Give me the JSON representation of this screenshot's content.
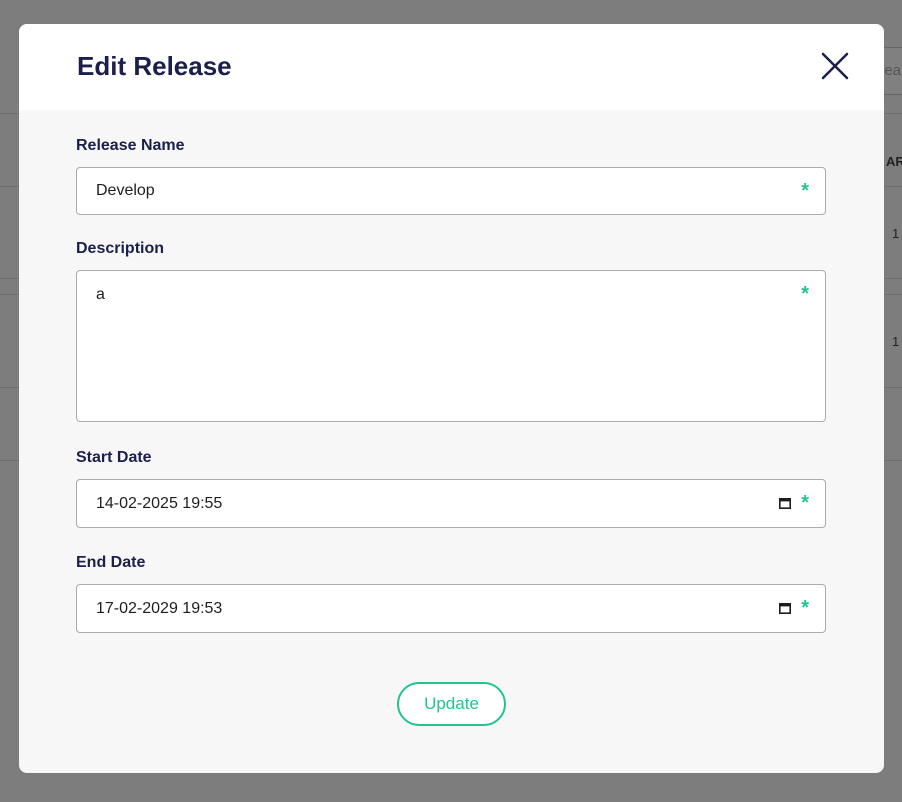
{
  "background": {
    "search_partial": "lea",
    "col_header_partial": "AR",
    "row1_partial": "1",
    "row2_partial": "1"
  },
  "modal": {
    "title": "Edit Release",
    "close_icon": "close-icon",
    "fields": {
      "release_name": {
        "label": "Release Name",
        "value": "Develop",
        "required_mark": "*"
      },
      "description": {
        "label": "Description",
        "value": "a",
        "required_mark": "*"
      },
      "start_date": {
        "label": "Start Date",
        "value": "14-02-2025 19:55",
        "required_mark": "*",
        "icon": "calendar-icon"
      },
      "end_date": {
        "label": "End Date",
        "value": "17-02-2029 19:53",
        "required_mark": "*",
        "icon": "calendar-icon"
      }
    },
    "update_label": "Update"
  },
  "colors": {
    "title": "#1b1f4b",
    "accent": "#22c38e",
    "overlay": "#7d7d7d"
  }
}
